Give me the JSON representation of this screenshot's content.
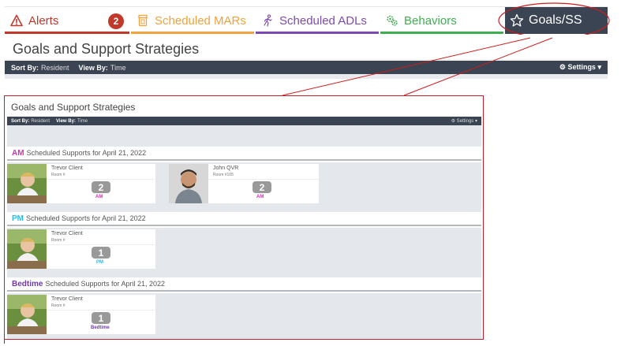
{
  "tabs": [
    {
      "label": "Alerts",
      "badge": "2",
      "color": "#c0392b",
      "icon": "warning-icon"
    },
    {
      "label": "Scheduled MARs",
      "color": "#f0a23b",
      "icon": "pill-bottle-icon"
    },
    {
      "label": "Scheduled ADLs",
      "color": "#7d4ab0",
      "icon": "walking-person-icon"
    },
    {
      "label": "Behaviors",
      "color": "#3fae52",
      "icon": "gears-icon"
    },
    {
      "label": "Goals/SS",
      "color": "#3a4452",
      "icon": "star-icon",
      "active": true
    }
  ],
  "page": {
    "title": "Goals and Support Strategies",
    "sort_by_label": "Sort By:",
    "sort_by_value": "Resident",
    "view_by_label": "View By:",
    "view_by_value": "Time",
    "settings_label": "Settings"
  },
  "zoom": {
    "title": "Goals and Support Strategies",
    "sort_by_label": "Sort By:",
    "sort_by_value": "Resident",
    "view_by_label": "View By:",
    "view_by_value": "Time",
    "settings_label": "Settings",
    "sections": [
      {
        "period": "AM",
        "period_color": "#d633b4",
        "heading": "Scheduled Supports for April 21, 2022",
        "cards": [
          {
            "name": "Trevor Client",
            "room": "Room #",
            "count": "2",
            "label": "AM"
          },
          {
            "name": "John QVR",
            "room": "Room #105",
            "count": "2",
            "label": "AM"
          }
        ]
      },
      {
        "period": "PM",
        "period_color": "#33b9e0",
        "heading": "Scheduled Supports for April 21, 2022",
        "cards": [
          {
            "name": "Trevor Client",
            "room": "Room #",
            "count": "1",
            "label": "PM"
          }
        ]
      },
      {
        "period": "Bedtime",
        "period_color": "#6f3aa8",
        "heading": "Scheduled Supports for April 21, 2022",
        "cards": [
          {
            "name": "Trevor Client",
            "room": "Room #",
            "count": "1",
            "label": "Bedtime"
          }
        ]
      }
    ]
  }
}
